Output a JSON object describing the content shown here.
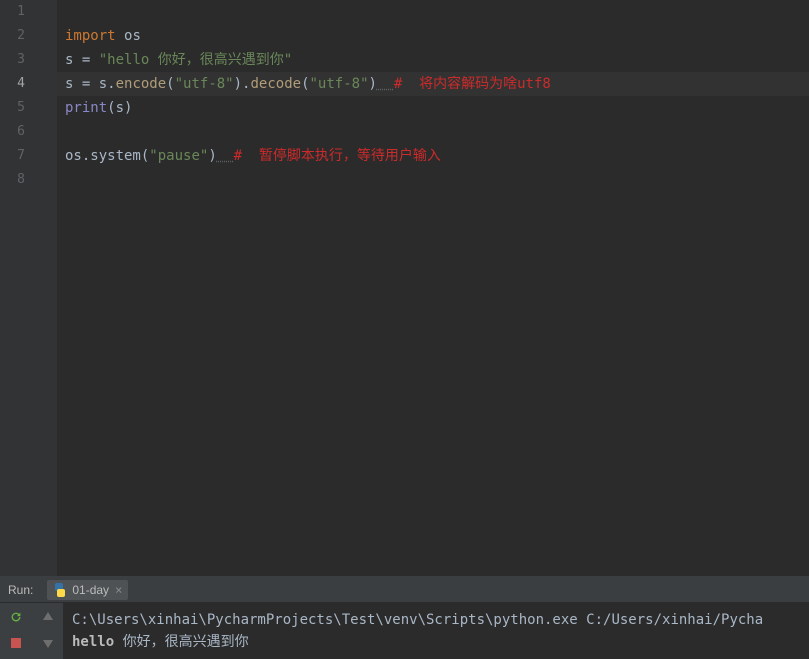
{
  "editor": {
    "lines": [
      {
        "num": "1",
        "tokens": []
      },
      {
        "num": "2",
        "tokens": [
          {
            "cls": "kw",
            "t": "import"
          },
          {
            "cls": "op",
            "t": " "
          },
          {
            "cls": "ident",
            "t": "os"
          }
        ]
      },
      {
        "num": "3",
        "tokens": [
          {
            "cls": "ident",
            "t": "s "
          },
          {
            "cls": "op",
            "t": "="
          },
          {
            "cls": "ident",
            "t": " "
          },
          {
            "cls": "str",
            "t": "\"hello 你好，很高兴遇到你\""
          }
        ]
      },
      {
        "num": "4",
        "current": true,
        "tokens": [
          {
            "cls": "ident",
            "t": "s "
          },
          {
            "cls": "op",
            "t": "="
          },
          {
            "cls": "ident",
            "t": " s."
          },
          {
            "cls": "fn",
            "t": "encode"
          },
          {
            "cls": "op",
            "t": "("
          },
          {
            "cls": "str",
            "t": "\"utf-8\""
          },
          {
            "cls": "op",
            "t": ")."
          },
          {
            "cls": "fn",
            "t": "decode"
          },
          {
            "cls": "op",
            "t": "("
          },
          {
            "cls": "str",
            "t": "\"utf-8\""
          },
          {
            "cls": "op",
            "t": ")"
          },
          {
            "cls": "underline",
            "t": "  "
          },
          {
            "cls": "comment",
            "t": "#  将内容解码为啥utf8"
          }
        ]
      },
      {
        "num": "5",
        "tokens": [
          {
            "cls": "fn2",
            "t": "print"
          },
          {
            "cls": "op",
            "t": "("
          },
          {
            "cls": "ident",
            "t": "s"
          },
          {
            "cls": "op",
            "t": ")"
          }
        ]
      },
      {
        "num": "6",
        "tokens": []
      },
      {
        "num": "7",
        "tokens": [
          {
            "cls": "ident",
            "t": "os.system("
          },
          {
            "cls": "str",
            "t": "\"pause\""
          },
          {
            "cls": "op",
            "t": ")"
          },
          {
            "cls": "underline",
            "t": "  "
          },
          {
            "cls": "comment",
            "t": "#  暂停脚本执行，等待用户输入"
          }
        ]
      },
      {
        "num": "8",
        "tokens": []
      }
    ]
  },
  "run": {
    "label": "Run:",
    "tab_name": "01-day",
    "output": [
      {
        "tokens": [
          {
            "cls": "",
            "t": "C:\\Users\\xinhai\\PycharmProjects\\Test\\venv\\Scripts\\python.exe C:/Users/xinhai/Pycha"
          }
        ]
      },
      {
        "tokens": [
          {
            "cls": "out-bold",
            "t": "hello"
          },
          {
            "cls": "",
            "t": " 你好，很高兴遇到你"
          }
        ]
      }
    ]
  }
}
